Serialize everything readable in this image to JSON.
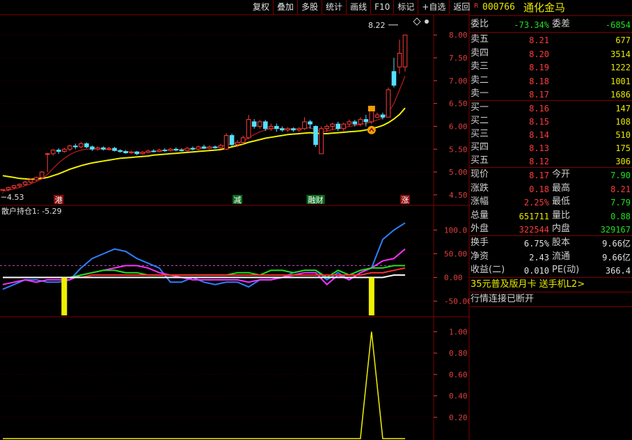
{
  "toolbar": {
    "items": [
      "复权",
      "叠加",
      "多股",
      "统计",
      "画线",
      "F10",
      "标记",
      "+自选",
      "返回"
    ]
  },
  "stock": {
    "badge": "R",
    "code": "000766",
    "name": "通化金马"
  },
  "order_book": {
    "weibi_label": "委比",
    "weibi_value": "-73.34%",
    "weicha_label": "委差",
    "weicha_value": "-6854",
    "asks": [
      {
        "label": "卖五",
        "price": "8.21",
        "vol": "677"
      },
      {
        "label": "卖四",
        "price": "8.20",
        "vol": "3514"
      },
      {
        "label": "卖三",
        "price": "8.19",
        "vol": "1222"
      },
      {
        "label": "卖二",
        "price": "8.18",
        "vol": "1001"
      },
      {
        "label": "卖一",
        "price": "8.17",
        "vol": "1686"
      }
    ],
    "bids": [
      {
        "label": "买一",
        "price": "8.16",
        "vol": "147"
      },
      {
        "label": "买二",
        "price": "8.15",
        "vol": "108"
      },
      {
        "label": "买三",
        "price": "8.14",
        "vol": "510"
      },
      {
        "label": "买四",
        "price": "8.13",
        "vol": "175"
      },
      {
        "label": "买五",
        "price": "8.12",
        "vol": "306"
      }
    ]
  },
  "quote": [
    {
      "l1": "现价",
      "v1": "8.17",
      "c1": "red",
      "l2": "今开",
      "v2": "7.90",
      "c2": "green"
    },
    {
      "l1": "涨跌",
      "v1": "0.18",
      "c1": "red",
      "l2": "最高",
      "v2": "8.21",
      "c2": "red"
    },
    {
      "l1": "涨幅",
      "v1": "2.25%",
      "c1": "red",
      "l2": "最低",
      "v2": "7.79",
      "c2": "green"
    },
    {
      "l1": "总量",
      "v1": "651711",
      "c1": "yellow",
      "l2": "量比",
      "v2": "0.88",
      "c2": "green"
    },
    {
      "l1": "外盘",
      "v1": "322544",
      "c1": "red",
      "l2": "内盘",
      "v2": "329167",
      "c2": "green"
    }
  ],
  "fundamentals": [
    {
      "l1": "换手",
      "v1": "6.75%",
      "l2": "股本",
      "v2": "9.66亿"
    },
    {
      "l1": "净资",
      "v1": "2.43",
      "l2": "流通",
      "v2": "9.66亿"
    },
    {
      "l1": "收益(二)",
      "v1": "0.010",
      "l2": "PE(动)",
      "v2": "366.4"
    }
  ],
  "ad_text": "35元普及版月卡 送手机L2>",
  "status_text": "行情连接已断开",
  "colors": {
    "border": "#800000",
    "axis": "#e0403c",
    "up_candle": "#ff3b3b",
    "down_candle": "#54e0ff",
    "ma_yellow": "#f0f000",
    "ma_red": "#e02020",
    "line_blue": "#2f7fff",
    "line_magenta": "#ff30ff",
    "line_green": "#20e020",
    "line_red": "#ff3030",
    "line_white": "#ffffff"
  },
  "chart_data": [
    {
      "type": "candlestick",
      "panel": "main",
      "ylim": [
        4.3,
        8.4
      ],
      "yticks": [
        4.5,
        5.0,
        5.5,
        6.0,
        6.5,
        7.0,
        7.5,
        8.0
      ],
      "ytick_labels": [
        "4.50",
        "5.00",
        "5.50",
        "6.00",
        "6.50",
        "7.00",
        "7.50",
        "8.00"
      ],
      "annotations": [
        {
          "text": "8.22",
          "kind": "high"
        },
        {
          "text": "4.53",
          "kind": "low"
        }
      ],
      "event_labels": [
        {
          "text": "港",
          "index": 10
        },
        {
          "text": "减",
          "index": 42
        },
        {
          "text": "融财",
          "index": 56
        },
        {
          "text": "涨",
          "index": 72
        }
      ],
      "candles": [
        [
          4.6,
          4.62,
          4.55,
          4.53
        ],
        [
          4.62,
          4.66,
          4.68,
          4.58
        ],
        [
          4.66,
          4.7,
          4.72,
          4.62
        ],
        [
          4.7,
          4.73,
          4.75,
          4.66
        ],
        [
          4.73,
          4.78,
          4.8,
          4.7
        ],
        [
          4.78,
          4.83,
          4.86,
          4.74
        ],
        [
          4.83,
          4.88,
          4.9,
          4.8
        ],
        [
          4.88,
          5.0,
          5.02,
          4.85
        ],
        [
          5.4,
          5.4,
          5.42,
          5.0
        ],
        [
          5.4,
          5.48,
          5.5,
          5.36
        ],
        [
          5.48,
          5.45,
          5.52,
          5.4
        ],
        [
          5.45,
          5.5,
          5.53,
          5.42
        ],
        [
          5.5,
          5.57,
          5.6,
          5.46
        ],
        [
          5.57,
          5.55,
          5.62,
          5.5
        ],
        [
          5.55,
          5.62,
          5.66,
          5.52
        ],
        [
          5.62,
          5.55,
          5.65,
          5.52
        ],
        [
          5.55,
          5.5,
          5.58,
          5.46
        ],
        [
          5.5,
          5.53,
          5.56,
          5.47
        ],
        [
          5.53,
          5.5,
          5.56,
          5.47
        ],
        [
          5.5,
          5.52,
          5.55,
          5.47
        ],
        [
          5.52,
          5.47,
          5.55,
          5.45
        ],
        [
          5.47,
          5.45,
          5.5,
          5.42
        ],
        [
          5.45,
          5.42,
          5.48,
          5.4
        ],
        [
          5.42,
          5.44,
          5.47,
          5.4
        ],
        [
          5.44,
          5.4,
          5.46,
          5.37
        ],
        [
          5.4,
          5.43,
          5.46,
          5.38
        ],
        [
          5.43,
          5.46,
          5.49,
          5.41
        ],
        [
          5.46,
          5.45,
          5.5,
          5.43
        ],
        [
          5.45,
          5.48,
          5.51,
          5.43
        ],
        [
          5.48,
          5.47,
          5.52,
          5.44
        ],
        [
          5.47,
          5.5,
          5.53,
          5.45
        ],
        [
          5.5,
          5.48,
          5.54,
          5.45
        ],
        [
          5.48,
          5.47,
          5.52,
          5.45
        ],
        [
          5.47,
          5.52,
          5.55,
          5.45
        ],
        [
          5.52,
          5.5,
          5.56,
          5.47
        ],
        [
          5.5,
          5.55,
          5.58,
          5.48
        ],
        [
          5.55,
          5.52,
          5.6,
          5.5
        ],
        [
          5.52,
          5.55,
          5.58,
          5.5
        ],
        [
          5.55,
          5.53,
          5.58,
          5.51
        ],
        [
          5.53,
          5.58,
          5.62,
          5.5
        ],
        [
          5.5,
          5.8,
          5.85,
          5.48
        ],
        [
          5.8,
          5.6,
          5.84,
          5.55
        ],
        [
          5.6,
          5.65,
          5.7,
          5.55
        ],
        [
          5.65,
          5.75,
          5.8,
          5.6
        ],
        [
          5.75,
          6.15,
          6.25,
          5.72
        ],
        [
          6.1,
          6.0,
          6.16,
          5.95
        ],
        [
          6.0,
          6.1,
          6.14,
          5.95
        ],
        [
          6.1,
          5.95,
          6.14,
          5.9
        ],
        [
          5.95,
          6.0,
          6.06,
          5.9
        ],
        [
          6.0,
          5.95,
          6.06,
          5.88
        ],
        [
          5.95,
          5.92,
          6.0,
          5.88
        ],
        [
          5.92,
          5.95,
          5.98,
          5.88
        ],
        [
          5.95,
          5.92,
          5.98,
          5.88
        ],
        [
          5.92,
          5.95,
          5.98,
          5.88
        ],
        [
          5.95,
          6.1,
          6.2,
          5.92
        ],
        [
          6.1,
          6.05,
          6.14,
          5.95
        ],
        [
          6.0,
          5.6,
          6.02,
          5.55
        ],
        [
          5.4,
          5.95,
          6.0,
          5.4
        ],
        [
          5.95,
          6.0,
          6.04,
          5.88
        ],
        [
          6.0,
          6.05,
          6.08,
          5.92
        ],
        [
          6.05,
          5.95,
          6.1,
          5.9
        ],
        [
          5.95,
          6.05,
          6.08,
          5.9
        ],
        [
          6.05,
          6.1,
          6.15,
          6.0
        ],
        [
          6.1,
          6.05,
          6.14,
          6.0
        ],
        [
          6.05,
          6.15,
          6.2,
          6.0
        ],
        [
          6.15,
          6.1,
          6.25,
          6.0
        ],
        [
          6.1,
          6.4,
          6.45,
          6.05
        ],
        [
          6.2,
          6.25,
          6.3,
          6.18
        ],
        [
          6.25,
          6.2,
          6.3,
          6.15
        ],
        [
          6.2,
          6.8,
          6.85,
          6.2
        ],
        [
          7.2,
          6.9,
          7.5,
          6.85
        ],
        [
          7.3,
          7.6,
          7.9,
          7.15
        ],
        [
          7.3,
          8.0,
          8.0,
          7.2
        ]
      ],
      "ma_yellow": [
        4.92,
        4.9,
        4.88,
        4.86,
        4.85,
        4.84,
        4.85,
        4.86,
        4.88,
        4.92,
        4.96,
        5.01,
        5.06,
        5.1,
        5.14,
        5.17,
        5.2,
        5.22,
        5.24,
        5.26,
        5.28,
        5.3,
        5.31,
        5.32,
        5.33,
        5.34,
        5.35,
        5.37,
        5.38,
        5.39,
        5.4,
        5.41,
        5.42,
        5.43,
        5.44,
        5.45,
        5.46,
        5.47,
        5.48,
        5.49,
        5.52,
        5.55,
        5.58,
        5.61,
        5.65,
        5.68,
        5.71,
        5.74,
        5.76,
        5.78,
        5.8,
        5.82,
        5.83,
        5.84,
        5.85,
        5.86,
        5.85,
        5.84,
        5.84,
        5.85,
        5.86,
        5.87,
        5.88,
        5.89,
        5.9,
        5.92,
        5.95,
        5.98,
        6.02,
        6.08,
        6.16,
        6.26,
        6.4
      ],
      "ma_red": [
        4.58,
        4.6,
        4.63,
        4.66,
        4.7,
        4.74,
        4.79,
        4.85,
        4.95,
        5.08,
        5.2,
        5.3,
        5.38,
        5.44,
        5.48,
        5.5,
        5.51,
        5.51,
        5.5,
        5.49,
        5.48,
        5.46,
        5.45,
        5.44,
        5.43,
        5.43,
        5.44,
        5.45,
        5.46,
        5.47,
        5.48,
        5.49,
        5.49,
        5.5,
        5.51,
        5.52,
        5.53,
        5.53,
        5.54,
        5.55,
        5.6,
        5.62,
        5.64,
        5.67,
        5.75,
        5.82,
        5.88,
        5.92,
        5.95,
        5.96,
        5.95,
        5.94,
        5.94,
        5.94,
        5.96,
        5.97,
        5.92,
        5.88,
        5.9,
        5.93,
        5.95,
        5.97,
        6.0,
        6.02,
        6.04,
        6.06,
        6.1,
        6.14,
        6.18,
        6.3,
        6.5,
        6.8,
        7.1
      ]
    },
    {
      "type": "line",
      "panel": "indicator",
      "title": "散户持仓1: -5.29",
      "ylim": [
        -80,
        130
      ],
      "yticks": [
        100,
        50,
        0,
        -50
      ],
      "ytick_labels": [
        "100.0",
        "50.00",
        "0.00",
        "-50.00"
      ],
      "x": [
        0,
        4,
        8,
        12,
        16,
        20,
        24,
        28,
        32,
        36,
        40,
        44,
        48,
        52,
        56,
        58,
        60,
        62,
        64,
        66,
        68,
        70,
        72
      ],
      "series": [
        {
          "color": "blue",
          "values": [
            -25,
            -15,
            -5,
            -5,
            -10,
            -10,
            -5,
            20,
            40,
            50,
            60,
            55,
            40,
            30,
            20,
            -10,
            -10,
            0,
            -10,
            -15,
            -10,
            -10,
            -20,
            -5,
            -5,
            0,
            10,
            15,
            15,
            -5,
            10,
            -5,
            10,
            20,
            80,
            100,
            115
          ]
        },
        {
          "color": "magenta",
          "values": [
            -15,
            -10,
            -5,
            -10,
            -5,
            -5,
            -5,
            5,
            10,
            15,
            20,
            25,
            25,
            20,
            10,
            5,
            0,
            -5,
            -5,
            -5,
            -5,
            -5,
            -10,
            -5,
            -5,
            0,
            5,
            10,
            10,
            -15,
            5,
            -5,
            10,
            20,
            35,
            40,
            60
          ]
        },
        {
          "color": "green",
          "values": [
            0,
            0,
            0,
            0,
            0,
            0,
            0,
            5,
            10,
            15,
            15,
            10,
            10,
            5,
            5,
            5,
            5,
            5,
            5,
            5,
            5,
            10,
            10,
            5,
            15,
            15,
            10,
            15,
            15,
            0,
            15,
            5,
            15,
            20,
            20,
            25,
            25
          ]
        },
        {
          "color": "red",
          "values": [
            0,
            0,
            0,
            0,
            0,
            0,
            0,
            0,
            5,
            5,
            5,
            5,
            5,
            5,
            5,
            5,
            5,
            5,
            5,
            5,
            5,
            5,
            5,
            5,
            5,
            5,
            5,
            5,
            5,
            5,
            5,
            5,
            5,
            10,
            10,
            15,
            20
          ]
        },
        {
          "color": "white",
          "values": [
            0,
            0,
            0,
            0,
            0,
            0,
            0,
            0,
            0,
            0,
            0,
            0,
            0,
            0,
            0,
            0,
            0,
            0,
            0,
            0,
            0,
            0,
            0,
            0,
            0,
            0,
            0,
            0,
            0,
            0,
            0,
            0,
            0,
            0,
            0,
            5,
            5
          ]
        }
      ],
      "bars": [
        {
          "index": 11,
          "value": -100,
          "color": "yellow"
        },
        {
          "index": 66,
          "value": -100,
          "color": "yellow"
        }
      ],
      "dashed_levels": [
        25
      ]
    },
    {
      "type": "line",
      "panel": "signal",
      "ylim": [
        0,
        1.12
      ],
      "yticks": [
        1.0,
        0.8,
        0.6,
        0.4,
        0.2
      ],
      "ytick_labels": [
        "1.00",
        "0.80",
        "0.60",
        "0.40",
        "0.20"
      ],
      "series": [
        {
          "color": "yellow",
          "points": [
            [
              0,
              0
            ],
            [
              64,
              0
            ],
            [
              66,
              1
            ],
            [
              68,
              0
            ],
            [
              72,
              0
            ]
          ]
        }
      ]
    }
  ]
}
